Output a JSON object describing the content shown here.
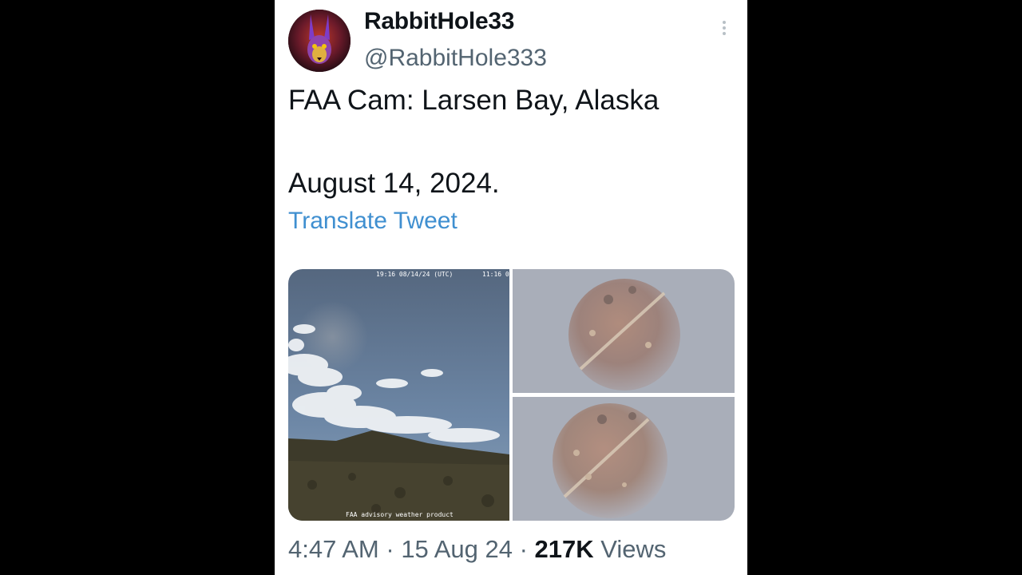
{
  "tweet": {
    "display_name": "RabbitHole33",
    "handle": "@RabbitHole333",
    "text": "FAA Cam: Larsen Bay, Alaska\n\nAugust 14, 2024.",
    "translate_label": "Translate Tweet",
    "more_icon": "more-vertical-icon",
    "avatar_icon": "rabbit-avatar"
  },
  "media": {
    "camera_timestamp": "19:16 08/14/24 (UTC)",
    "camera_timestamp_2": "11:16 0",
    "camera_caption": "FAA advisory weather product"
  },
  "meta": {
    "time": "4:47 AM",
    "separator_1": " · ",
    "date": "15 Aug 24",
    "separator_2": " · ",
    "views_count": "217K",
    "views_label": " Views"
  },
  "colors": {
    "link": "#3f8fd0",
    "muted_text": "#536471",
    "primary_text": "#0f1419",
    "background": "#000000"
  }
}
